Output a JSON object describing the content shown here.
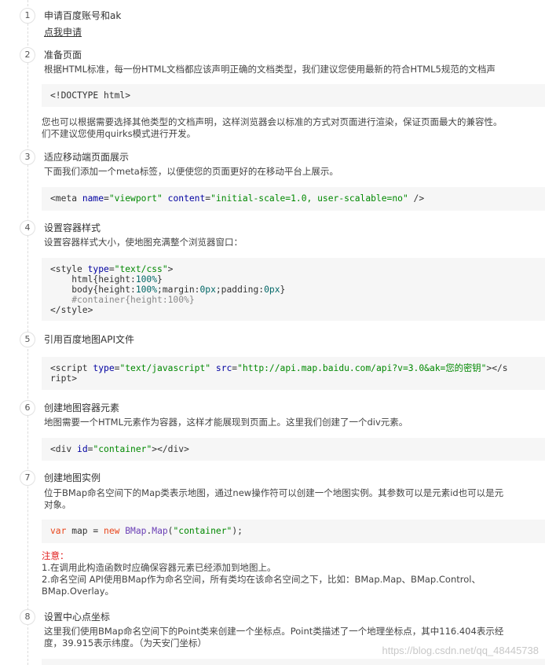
{
  "steps": [
    {
      "num": "1",
      "title": "申请百度账号和ak",
      "link": "点我申请"
    },
    {
      "num": "2",
      "title": "准备页面",
      "desc": "根据HTML标准，每一份HTML文档都应该声明正确的文档类型，我们建议您使用最新的符合HTML5规范的文档声",
      "code": "<!DOCTYPE html>",
      "after_line1": "您也可以根据需要选择其他类型的文档声明，这样浏览器会以标准的方式对页面进行渲染，保证页面最大的兼容性。",
      "after_line2": "们不建议您使用quirks模式进行开发。"
    },
    {
      "num": "3",
      "title": "适应移动端页面展示",
      "desc": "下面我们添加一个meta标签，以便使您的页面更好的在移动平台上展示。",
      "code": {
        "p1": "<meta ",
        "a1": "name",
        "p2": "=",
        "v1": "\"viewport\"",
        "p3": " ",
        "a2": "content",
        "p4": "=",
        "v2": "\"initial-scale=1.0, user-scalable=no\"",
        "p5": " />"
      }
    },
    {
      "num": "4",
      "title": "设置容器样式",
      "desc": "设置容器样式大小，使地图充满整个浏览器窗口：",
      "code": {
        "l1a": "<style ",
        "l1b": "type",
        "l1c": "=",
        "l1d": "\"text/css\"",
        "l1e": ">",
        "l2a": "    html{height:",
        "l2b": "100%",
        "l2c": "}",
        "l3a": "    body{height:",
        "l3b": "100%",
        "l3c": ";margin:",
        "l3d": "0px",
        "l3e": ";padding:",
        "l3f": "0px",
        "l3g": "}",
        "l4": "    #container{height:100%}",
        "l5": "</style>"
      }
    },
    {
      "num": "5",
      "title": "引用百度地图API文件",
      "code": {
        "a": "<script ",
        "b": "type",
        "c": "=",
        "d": "\"text/javascript\"",
        "e": " ",
        "f": "src",
        "g": "=",
        "h": "\"http://api.map.baidu.com/api?v=3.0&ak=",
        "i": "您的密钥",
        "j": "\"",
        "k": "></s",
        "l2": "ript>"
      }
    },
    {
      "num": "6",
      "title": "创建地图容器元素",
      "desc": "地图需要一个HTML元素作为容器，这样才能展现到页面上。这里我们创建了一个div元素。",
      "code": {
        "a": "<div ",
        "b": "id",
        "c": "=",
        "d": "\"container\"",
        "e": "></div>"
      }
    },
    {
      "num": "7",
      "title": "创建地图实例",
      "desc1": "位于BMap命名空间下的Map类表示地图，通过new操作符可以创建一个地图实例。其参数可以是元素id也可以是元",
      "desc2": "对象。",
      "code": {
        "a": "var",
        "b": " map = ",
        "c": "new",
        "d": " ",
        "e": "BMap",
        "f": ".",
        "g": "Map",
        "h": "(",
        "i": "\"container\"",
        "j": ");"
      },
      "note_label": "注意：",
      "note1": "1.在调用此构造函数时应确保容器元素已经添加到地图上。",
      "note2": "2.命名空间 API使用BMap作为命名空间，所有类均在该命名空间之下，比如：BMap.Map、BMap.Control、",
      "note3": "BMap.Overlay。"
    },
    {
      "num": "8",
      "title": "设置中心点坐标",
      "desc1": "这里我们使用BMap命名空间下的Point类来创建一个坐标点。Point类描述了一个地理坐标点，其中116.404表示经",
      "desc2": "度，39.915表示纬度。（为天安门坐标）"
    }
  ],
  "watermark": "https://blog.csdn.net/qq_48445738",
  "colors": {
    "keyword_blue": "#0000a0",
    "string_green": "#008800",
    "keyword_red": "#e8461c",
    "note_red": "#e02020",
    "code_bg": "#f6f6f6"
  }
}
